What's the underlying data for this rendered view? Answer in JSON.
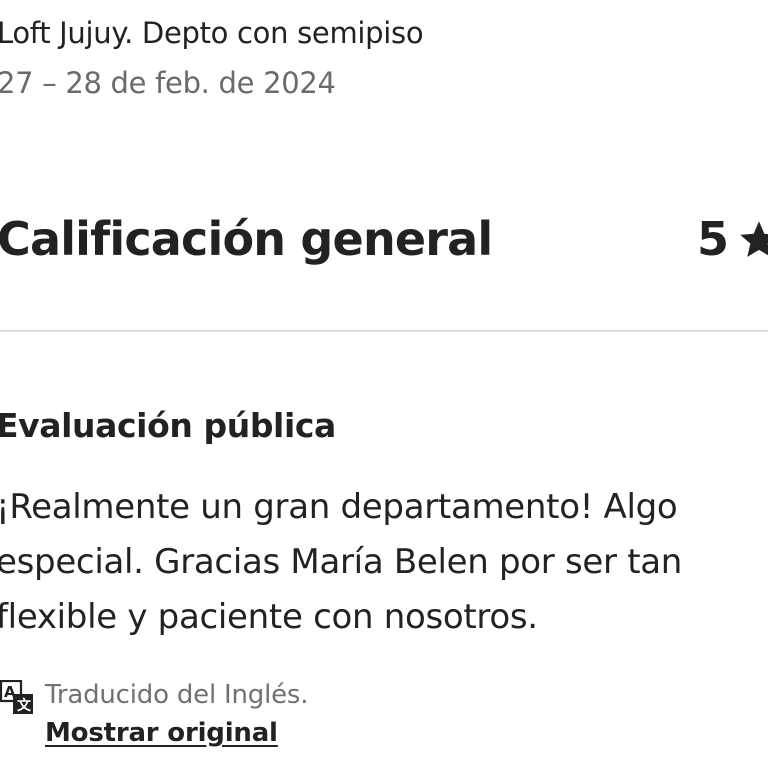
{
  "stay": {
    "listing_title": "Loft Jujuy. Depto con semipiso",
    "dates": "27 – 28 de feb. de 2024"
  },
  "overall_rating": {
    "heading": "Calificación general",
    "value": "5",
    "icon": "star-icon"
  },
  "public_review": {
    "heading": "Evaluación pública",
    "text": "¡Realmente un gran departamento! Algo especial. Gracias María Belen por ser tan flexible y paciente con nosotros."
  },
  "translation": {
    "icon": "translate-icon",
    "note": "Traducido del Inglés.",
    "link_label": "Mostrar original"
  },
  "colors": {
    "primary_text": "#222222",
    "secondary_text": "#6a6a6a",
    "divider": "#dddddd"
  }
}
